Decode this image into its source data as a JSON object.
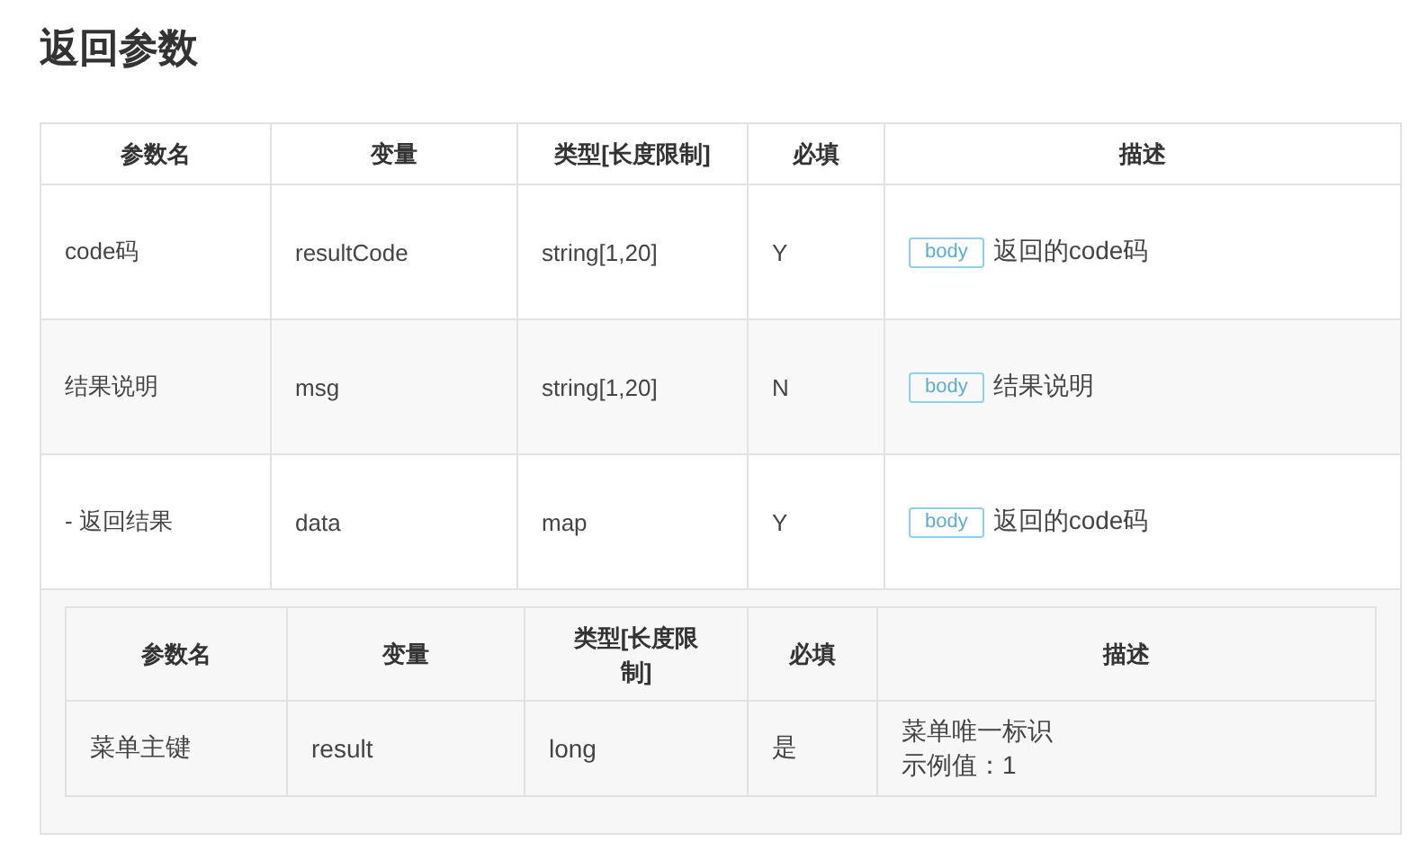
{
  "title": "返回参数",
  "table": {
    "columns": [
      "参数名",
      "变量",
      "类型[长度限制]",
      "必填",
      "描述"
    ],
    "rows": [
      {
        "name": "code码",
        "variable": "resultCode",
        "type": "string[1,20]",
        "required": "Y",
        "tag": "body",
        "description": "返回的code码"
      },
      {
        "name": "结果说明",
        "variable": "msg",
        "type": "string[1,20]",
        "required": "N",
        "tag": "body",
        "description": "结果说明"
      },
      {
        "name": "- 返回结果",
        "variable": "data",
        "type": "map",
        "required": "Y",
        "tag": "body",
        "description": "返回的code码",
        "nested_table": {
          "columns": [
            "参数名",
            "变量",
            "类型[长度限制]",
            "必填",
            "描述"
          ],
          "rows": [
            {
              "name": "菜单主键",
              "variable": "result",
              "type": "long",
              "required": "是",
              "description_lines": [
                "菜单唯一标识",
                "示例值：1"
              ]
            }
          ]
        }
      }
    ]
  }
}
